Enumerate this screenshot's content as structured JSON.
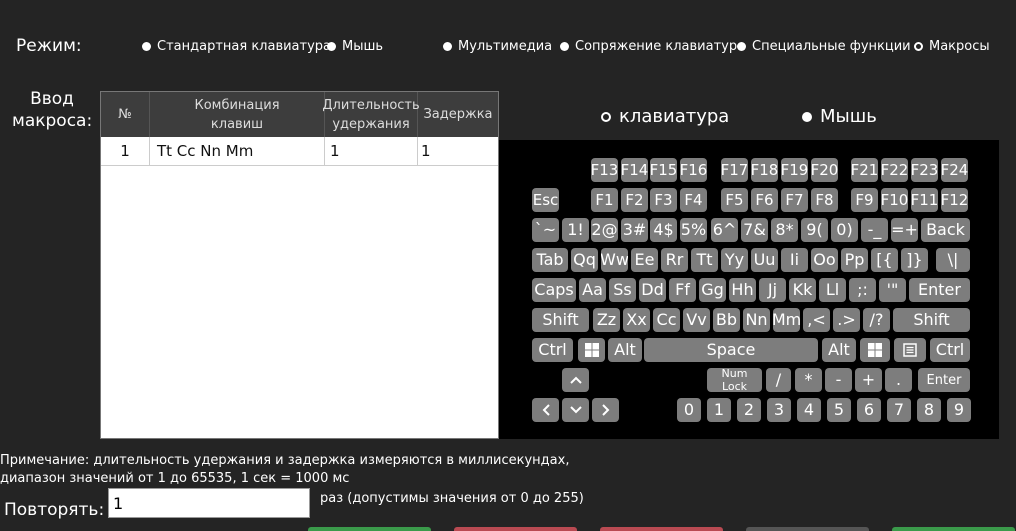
{
  "mode": {
    "label": "Режим:",
    "options": [
      {
        "label": "Стандартная клавиатура",
        "selected": false
      },
      {
        "label": "Мышь",
        "selected": false
      },
      {
        "label": "Мультимедиа",
        "selected": false
      },
      {
        "label": "Сопряжение клавиатур",
        "selected": false
      },
      {
        "label": "Специальные функции",
        "selected": false
      },
      {
        "label": "Макросы",
        "selected": true
      }
    ]
  },
  "macro": {
    "label_line1": "Ввод",
    "label_line2": "макроса:",
    "columns": [
      "№",
      "Комбинация клавиш",
      "Длительность удержания",
      "Задержка"
    ],
    "rows": [
      {
        "num": "1",
        "combo": "Tt Cc Nn Mm",
        "hold": "1",
        "delay": "1"
      }
    ]
  },
  "input_type": {
    "options": [
      {
        "label": "клавиатура",
        "selected": true
      },
      {
        "label": "Мышь",
        "selected": false
      }
    ]
  },
  "keyboard": {
    "rows": [
      [
        "F13",
        "F14",
        "F15",
        "F16",
        "F17",
        "F18",
        "F19",
        "F20",
        "F21",
        "F22",
        "F23",
        "F24"
      ],
      [
        "Esc",
        "F1",
        "F2",
        "F3",
        "F4",
        "F5",
        "F6",
        "F7",
        "F8",
        "F9",
        "F10",
        "F11",
        "F12"
      ],
      [
        "`~",
        "1!",
        "2@",
        "3#",
        "4$",
        "5%",
        "6^",
        "7&",
        "8*",
        "9(",
        "0)",
        "-_",
        "=+",
        "Back"
      ],
      [
        "Tab",
        "Qq",
        "Ww",
        "Ee",
        "Rr",
        "Tt",
        "Yy",
        "Uu",
        "Ii",
        "Oo",
        "Pp",
        "[{",
        "]}",
        "\\|"
      ],
      [
        "Caps",
        "Aa",
        "Ss",
        "Dd",
        "Ff",
        "Gg",
        "Hh",
        "Jj",
        "Kk",
        "Ll",
        ";:",
        "'\"",
        "Enter"
      ],
      [
        "Shift",
        "Zz",
        "Xx",
        "Cc",
        "Vv",
        "Bb",
        "Nn",
        "Mm",
        ",<",
        ".>",
        "/?",
        "Shift"
      ],
      [
        "Ctrl",
        "win-icon",
        "Alt",
        "Space",
        "Alt",
        "win-icon",
        "menu-icon",
        "Ctrl"
      ]
    ],
    "arrows": {
      "up": "arrow-up-icon",
      "left": "arrow-left-icon",
      "down": "arrow-down-icon",
      "right": "arrow-right-icon"
    },
    "numpad_ops": [
      "Num\nLock",
      "/",
      "*",
      "-",
      "+",
      ".",
      "Enter"
    ],
    "numpad_digits": [
      "0",
      "1",
      "2",
      "3",
      "4",
      "5",
      "6",
      "7",
      "8",
      "9"
    ]
  },
  "note": {
    "line1": "Примечание: длительность удержания и задержка измеряются в миллисекундах,",
    "line2": "диапазон значений от 1 до 65535, 1 сек = 1000 мс"
  },
  "repeat": {
    "label": "Повторять:",
    "value": "1",
    "hint": "раз (допустимы значения от 0 до 255)"
  },
  "colors": {
    "background": "#242424",
    "key": "#7d7d7d",
    "keyboard_bg": "#000000"
  }
}
